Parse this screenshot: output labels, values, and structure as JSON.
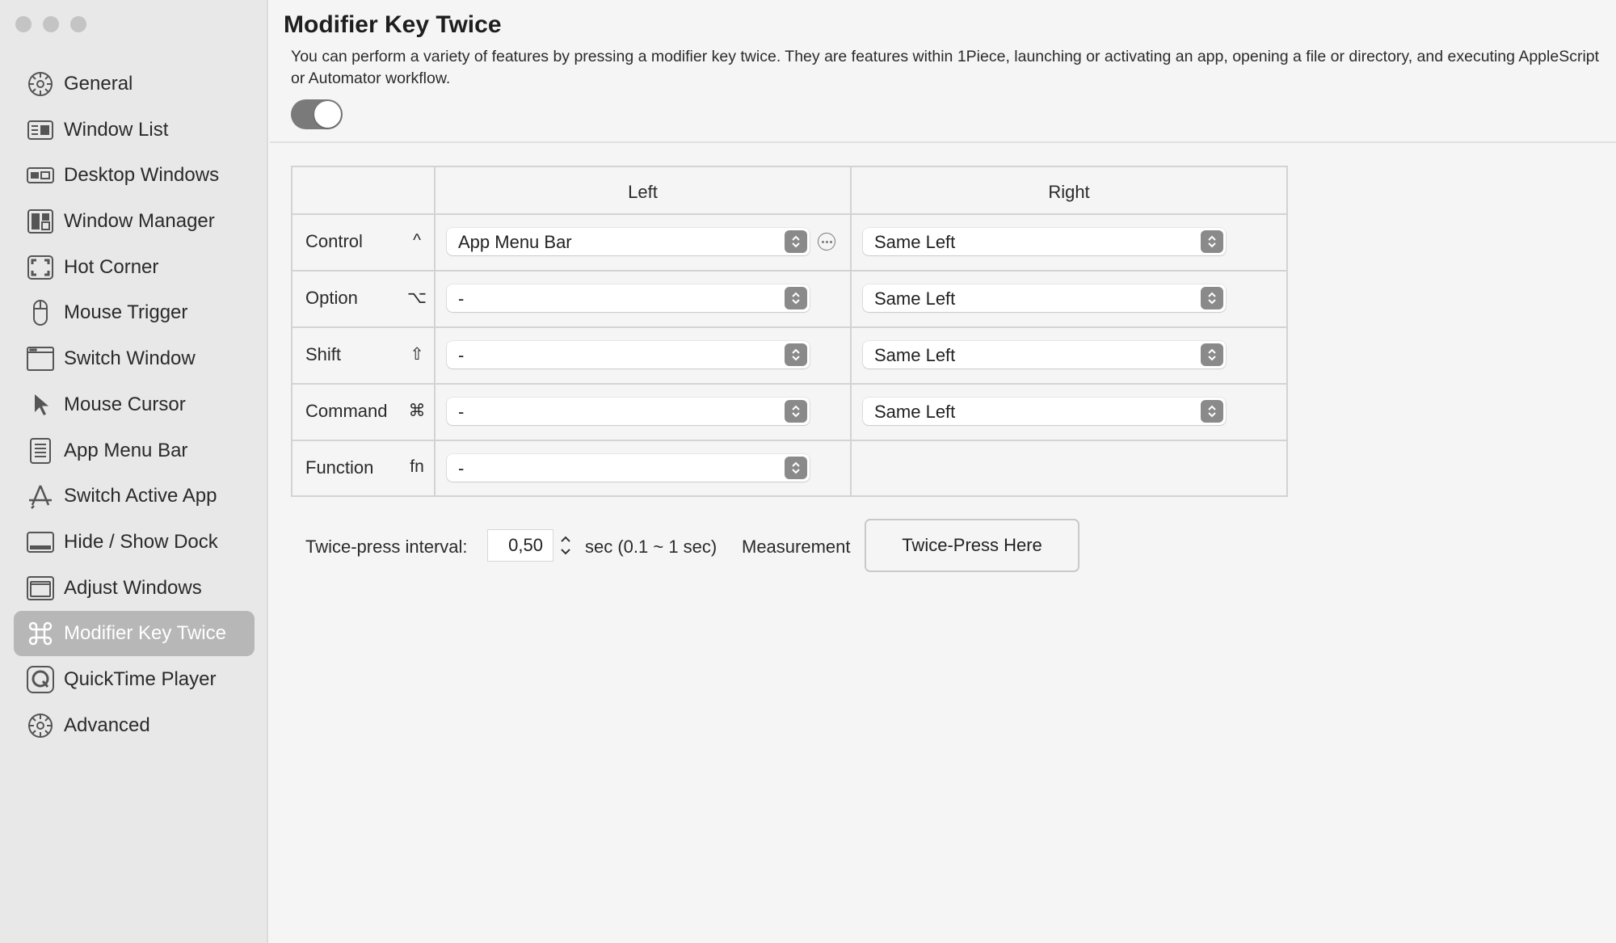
{
  "sidebar": {
    "items": [
      {
        "label": "General",
        "icon": "gear-icon"
      },
      {
        "label": "Window List",
        "icon": "window-list-icon"
      },
      {
        "label": "Desktop Windows",
        "icon": "desktop-windows-icon"
      },
      {
        "label": "Window Manager",
        "icon": "window-manager-icon"
      },
      {
        "label": "Hot Corner",
        "icon": "hot-corner-icon"
      },
      {
        "label": "Mouse Trigger",
        "icon": "mouse-icon"
      },
      {
        "label": "Switch Window",
        "icon": "switch-window-icon"
      },
      {
        "label": "Mouse Cursor",
        "icon": "cursor-icon"
      },
      {
        "label": "App Menu Bar",
        "icon": "menu-bar-icon"
      },
      {
        "label": "Switch Active App",
        "icon": "app-store-icon"
      },
      {
        "label": "Hide / Show Dock",
        "icon": "dock-icon"
      },
      {
        "label": "Adjust Windows",
        "icon": "adjust-windows-icon"
      },
      {
        "label": "Modifier Key Twice",
        "icon": "command-icon",
        "active": true
      },
      {
        "label": "QuickTime Player",
        "icon": "quicktime-icon"
      },
      {
        "label": "Advanced",
        "icon": "gear-icon"
      }
    ]
  },
  "main": {
    "title": "Modifier Key Twice",
    "description": "You can perform a variety of features by pressing a modifier key twice. They are features within 1Piece, launching or activating an app, opening a file or directory, and executing AppleScript or Automator workflow.",
    "enabled": true,
    "table": {
      "headers": [
        "Left",
        "Right"
      ],
      "rows": [
        {
          "key": "Control",
          "symbol": "^",
          "left": "App Menu Bar",
          "right": "Same Left",
          "has_more": true
        },
        {
          "key": "Option",
          "symbol": "⌥",
          "left": "-",
          "right": "Same Left"
        },
        {
          "key": "Shift",
          "symbol": "⇧",
          "left": "-",
          "right": "Same Left"
        },
        {
          "key": "Command",
          "symbol": "⌘",
          "left": "-",
          "right": "Same Left"
        },
        {
          "key": "Function",
          "symbol": "fn",
          "left": "-",
          "right": null
        }
      ]
    },
    "interval": {
      "label": "Twice-press interval:",
      "value": "0,50",
      "unit": "sec (0.1 ~ 1 sec)",
      "measurement_label": "Measurement",
      "button_label": "Twice-Press Here"
    }
  },
  "colors": {
    "sidebar_bg": "#e8e8e8",
    "main_bg": "#f5f5f5",
    "active_item_bg": "#b7b7b7",
    "toggle_on": "#7a7a7a"
  }
}
